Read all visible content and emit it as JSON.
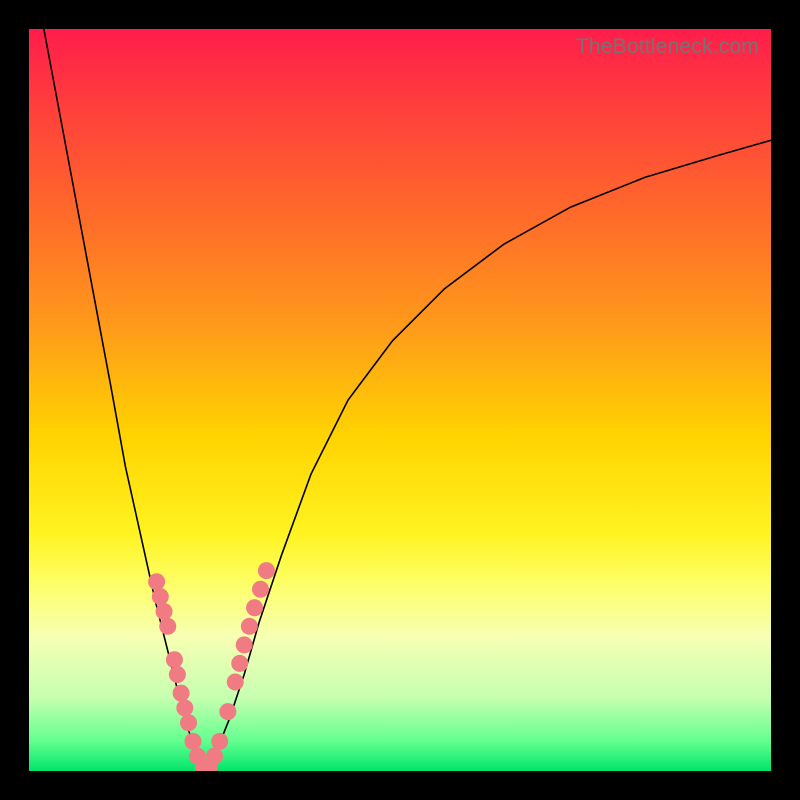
{
  "watermark": "TheBottleneck.com",
  "colors": {
    "frame": "#000000",
    "gradient_top": "#ff1d4b",
    "gradient_bottom": "#00e56a",
    "curve": "#000000",
    "bead": "#f07b82"
  },
  "chart_data": {
    "type": "line",
    "title": "",
    "xlabel": "",
    "ylabel": "",
    "xlim": [
      0,
      100
    ],
    "ylim": [
      0,
      100
    ],
    "note": "no axes or tick labels visible; values estimated from pixel positions on a 0-100 normalized canvas; y increases upward",
    "series": [
      {
        "name": "left-branch",
        "x": [
          2,
          5,
          8,
          11,
          13,
          15,
          17,
          18.5,
          20,
          21,
          22,
          23,
          23.8
        ],
        "y": [
          100,
          84,
          68,
          52,
          41,
          32,
          23,
          17,
          11,
          7,
          4,
          1.5,
          0
        ]
      },
      {
        "name": "right-branch",
        "x": [
          23.8,
          25,
          27,
          29,
          31,
          34,
          38,
          43,
          49,
          56,
          64,
          73,
          83,
          93,
          100
        ],
        "y": [
          0,
          2,
          7,
          13,
          20,
          29,
          40,
          50,
          58,
          65,
          71,
          76,
          80,
          83,
          85
        ]
      }
    ],
    "markers": {
      "name": "pink-beads",
      "points": [
        {
          "x": 17.2,
          "y": 25.5
        },
        {
          "x": 17.7,
          "y": 23.5
        },
        {
          "x": 18.2,
          "y": 21.5
        },
        {
          "x": 18.7,
          "y": 19.5
        },
        {
          "x": 19.6,
          "y": 15.0
        },
        {
          "x": 20.0,
          "y": 13.0
        },
        {
          "x": 20.5,
          "y": 10.5
        },
        {
          "x": 21.0,
          "y": 8.5
        },
        {
          "x": 21.5,
          "y": 6.5
        },
        {
          "x": 22.1,
          "y": 4.0
        },
        {
          "x": 22.7,
          "y": 2.0
        },
        {
          "x": 23.5,
          "y": 0.5
        },
        {
          "x": 24.3,
          "y": 0.5
        },
        {
          "x": 25.0,
          "y": 2.0
        },
        {
          "x": 25.7,
          "y": 4.0
        },
        {
          "x": 26.8,
          "y": 8.0
        },
        {
          "x": 27.8,
          "y": 12.0
        },
        {
          "x": 28.4,
          "y": 14.5
        },
        {
          "x": 29.0,
          "y": 17.0
        },
        {
          "x": 29.7,
          "y": 19.5
        },
        {
          "x": 30.4,
          "y": 22.0
        },
        {
          "x": 31.2,
          "y": 24.5
        },
        {
          "x": 32.0,
          "y": 27.0
        }
      ]
    }
  }
}
